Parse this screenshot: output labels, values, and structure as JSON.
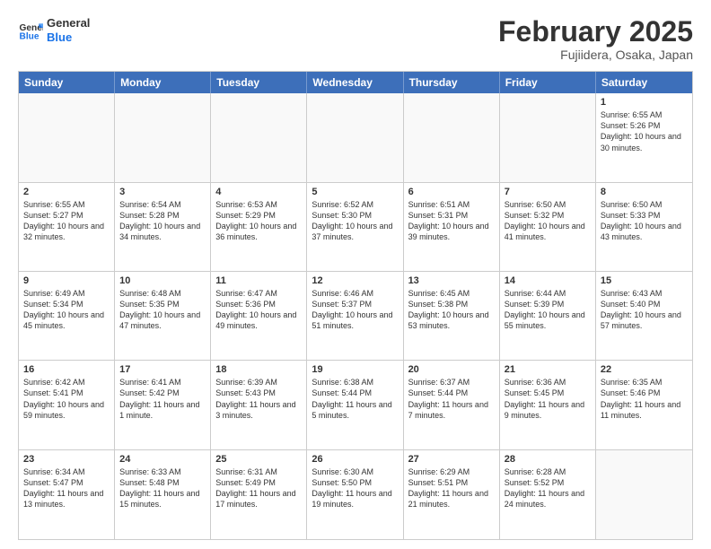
{
  "header": {
    "logo_general": "General",
    "logo_blue": "Blue",
    "month_year": "February 2025",
    "location": "Fujiidera, Osaka, Japan"
  },
  "calendar": {
    "days_of_week": [
      "Sunday",
      "Monday",
      "Tuesday",
      "Wednesday",
      "Thursday",
      "Friday",
      "Saturday"
    ],
    "rows": [
      [
        {
          "day": "",
          "text": "",
          "empty": true
        },
        {
          "day": "",
          "text": "",
          "empty": true
        },
        {
          "day": "",
          "text": "",
          "empty": true
        },
        {
          "day": "",
          "text": "",
          "empty": true
        },
        {
          "day": "",
          "text": "",
          "empty": true
        },
        {
          "day": "",
          "text": "",
          "empty": true
        },
        {
          "day": "1",
          "text": "Sunrise: 6:55 AM\nSunset: 5:26 PM\nDaylight: 10 hours and 30 minutes."
        }
      ],
      [
        {
          "day": "2",
          "text": "Sunrise: 6:55 AM\nSunset: 5:27 PM\nDaylight: 10 hours and 32 minutes."
        },
        {
          "day": "3",
          "text": "Sunrise: 6:54 AM\nSunset: 5:28 PM\nDaylight: 10 hours and 34 minutes."
        },
        {
          "day": "4",
          "text": "Sunrise: 6:53 AM\nSunset: 5:29 PM\nDaylight: 10 hours and 36 minutes."
        },
        {
          "day": "5",
          "text": "Sunrise: 6:52 AM\nSunset: 5:30 PM\nDaylight: 10 hours and 37 minutes."
        },
        {
          "day": "6",
          "text": "Sunrise: 6:51 AM\nSunset: 5:31 PM\nDaylight: 10 hours and 39 minutes."
        },
        {
          "day": "7",
          "text": "Sunrise: 6:50 AM\nSunset: 5:32 PM\nDaylight: 10 hours and 41 minutes."
        },
        {
          "day": "8",
          "text": "Sunrise: 6:50 AM\nSunset: 5:33 PM\nDaylight: 10 hours and 43 minutes."
        }
      ],
      [
        {
          "day": "9",
          "text": "Sunrise: 6:49 AM\nSunset: 5:34 PM\nDaylight: 10 hours and 45 minutes."
        },
        {
          "day": "10",
          "text": "Sunrise: 6:48 AM\nSunset: 5:35 PM\nDaylight: 10 hours and 47 minutes."
        },
        {
          "day": "11",
          "text": "Sunrise: 6:47 AM\nSunset: 5:36 PM\nDaylight: 10 hours and 49 minutes."
        },
        {
          "day": "12",
          "text": "Sunrise: 6:46 AM\nSunset: 5:37 PM\nDaylight: 10 hours and 51 minutes."
        },
        {
          "day": "13",
          "text": "Sunrise: 6:45 AM\nSunset: 5:38 PM\nDaylight: 10 hours and 53 minutes."
        },
        {
          "day": "14",
          "text": "Sunrise: 6:44 AM\nSunset: 5:39 PM\nDaylight: 10 hours and 55 minutes."
        },
        {
          "day": "15",
          "text": "Sunrise: 6:43 AM\nSunset: 5:40 PM\nDaylight: 10 hours and 57 minutes."
        }
      ],
      [
        {
          "day": "16",
          "text": "Sunrise: 6:42 AM\nSunset: 5:41 PM\nDaylight: 10 hours and 59 minutes."
        },
        {
          "day": "17",
          "text": "Sunrise: 6:41 AM\nSunset: 5:42 PM\nDaylight: 11 hours and 1 minute."
        },
        {
          "day": "18",
          "text": "Sunrise: 6:39 AM\nSunset: 5:43 PM\nDaylight: 11 hours and 3 minutes."
        },
        {
          "day": "19",
          "text": "Sunrise: 6:38 AM\nSunset: 5:44 PM\nDaylight: 11 hours and 5 minutes."
        },
        {
          "day": "20",
          "text": "Sunrise: 6:37 AM\nSunset: 5:44 PM\nDaylight: 11 hours and 7 minutes."
        },
        {
          "day": "21",
          "text": "Sunrise: 6:36 AM\nSunset: 5:45 PM\nDaylight: 11 hours and 9 minutes."
        },
        {
          "day": "22",
          "text": "Sunrise: 6:35 AM\nSunset: 5:46 PM\nDaylight: 11 hours and 11 minutes."
        }
      ],
      [
        {
          "day": "23",
          "text": "Sunrise: 6:34 AM\nSunset: 5:47 PM\nDaylight: 11 hours and 13 minutes."
        },
        {
          "day": "24",
          "text": "Sunrise: 6:33 AM\nSunset: 5:48 PM\nDaylight: 11 hours and 15 minutes."
        },
        {
          "day": "25",
          "text": "Sunrise: 6:31 AM\nSunset: 5:49 PM\nDaylight: 11 hours and 17 minutes."
        },
        {
          "day": "26",
          "text": "Sunrise: 6:30 AM\nSunset: 5:50 PM\nDaylight: 11 hours and 19 minutes."
        },
        {
          "day": "27",
          "text": "Sunrise: 6:29 AM\nSunset: 5:51 PM\nDaylight: 11 hours and 21 minutes."
        },
        {
          "day": "28",
          "text": "Sunrise: 6:28 AM\nSunset: 5:52 PM\nDaylight: 11 hours and 24 minutes."
        },
        {
          "day": "",
          "text": "",
          "empty": true
        }
      ]
    ]
  }
}
